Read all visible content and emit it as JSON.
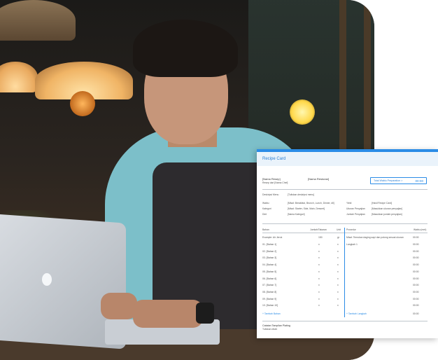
{
  "card": {
    "title": "Recipe Card",
    "recipe_name": "[Nama Resep]",
    "recipe_from": "Resep dari [Nama Chef]",
    "restaurant": "[Nama Restoran]",
    "total_prep_label": "Total Waktu Preparation",
    "total_prep_value": "00:00",
    "description_label": "Deskripsi Menu",
    "description_value": "[Tuliskan deskripsi menu]",
    "meta_left": [
      {
        "label": "Waktu",
        "value": "[Misal: Breakfast, Brunch, Lunch, Dinner, dll]"
      },
      {
        "label": "Kategori",
        "value": "[Misal: Starter, Side, Main, Dessert]"
      },
      {
        "label": "Diet",
        "value": "[Nama Kategori]"
      }
    ],
    "meta_right": [
      {
        "label": "Yield",
        "value": "[Hasil Recipe Card]"
      },
      {
        "label": "Ukuran Penyajian",
        "value": "[Masukkan ukuran penyajian]"
      },
      {
        "label": "Jumlah Penyajian",
        "value": "[Masukkan jumlah penyajian]"
      }
    ],
    "table_headers": {
      "ingredient": "Bahan",
      "amount": "Jumlah/Takaran",
      "unit": "Unit",
      "procedure": "Prosedur",
      "time": "Waktu (mnt)"
    },
    "example_row": {
      "name": "Example: Air Jeruk",
      "amount": "150",
      "unit": "gr"
    },
    "ingredient_rows": [
      {
        "name": "01. [Bahan 1]",
        "amount": "x",
        "unit": "x"
      },
      {
        "name": "02. [Bahan 2]",
        "amount": "x",
        "unit": "x"
      },
      {
        "name": "03. [Bahan 3]",
        "amount": "x",
        "unit": "x"
      },
      {
        "name": "04. [Bahan 4]",
        "amount": "x",
        "unit": "x"
      },
      {
        "name": "05. [Bahan 5]",
        "amount": "x",
        "unit": "x"
      },
      {
        "name": "06. [Bahan 6]",
        "amount": "x",
        "unit": "x"
      },
      {
        "name": "07. [Bahan 7]",
        "amount": "x",
        "unit": "x"
      },
      {
        "name": "08. [Bahan 8]",
        "amount": "x",
        "unit": "x"
      },
      {
        "name": "09. [Bahan 9]",
        "amount": "x",
        "unit": "x"
      },
      {
        "name": "10. [Bahan 10]",
        "amount": "x",
        "unit": "x"
      }
    ],
    "procedure_example": {
      "text": "Misal: Temukan daging sapi dan potong sesuai ukuran",
      "time": "00:00"
    },
    "procedure_step_1": "Langkah 1",
    "procedure_times": [
      "00:00",
      "00:00",
      "00:00",
      "00:00",
      "00:00",
      "00:00",
      "00:00",
      "00:00",
      "00:00",
      "00:00"
    ],
    "add_ingredient": "+ Tambah Bahan",
    "add_step": "+ Tambah Langkah",
    "add_step_time": "00:00",
    "plating_title": "Catatan Tampilan Plating",
    "plating_value": "Tuliskan disini"
  }
}
